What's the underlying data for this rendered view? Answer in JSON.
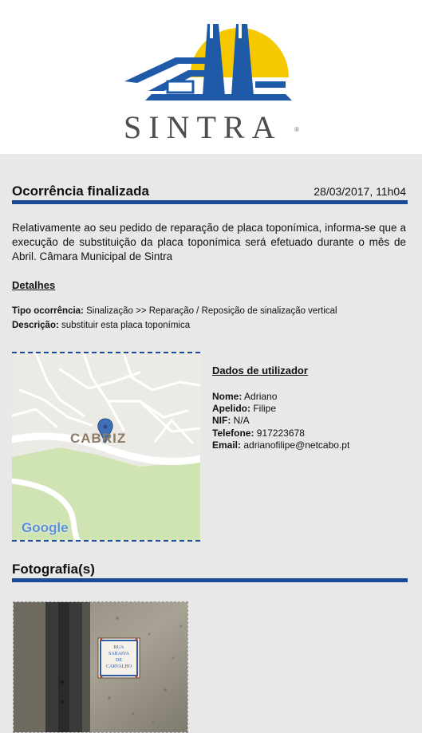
{
  "header": {
    "brand_text": "SINTRA",
    "brand_mark": "®"
  },
  "occurrence": {
    "title": "Ocorrência finalizada",
    "date": "28/03/2017, 11h04",
    "message": "Relativamente ao seu pedido de reparação de placa toponímica, informa-se que a execução de substituição da placa toponímica será efetuado durante o mês de Abril. Câmara Municipal de Sintra"
  },
  "details": {
    "heading": "Detalhes",
    "type_label": "Tipo ocorrência:",
    "type_value": "Sinalização >> Reparação / Reposição de sinalização vertical",
    "description_label": "Descrição:",
    "description_value": "substituir esta placa toponímica"
  },
  "map": {
    "place_label": "CABRIZ",
    "attribution": "Google",
    "marker_icon": "map-pin-icon"
  },
  "user": {
    "heading": "Dados de utilizador",
    "name_label": "Nome:",
    "name_value": "Adriano",
    "surname_label": "Apelido:",
    "surname_value": "Filipe",
    "nif_label": "NIF:",
    "nif_value": "N/A",
    "phone_label": "Telefone:",
    "phone_value": "917223678",
    "email_label": "Email:",
    "email_value": "adrianofilipe@netcabo.pt"
  },
  "photos": {
    "heading": "Fotografia(s)",
    "sign_text_1": "RUA",
    "sign_text_2": "SARAIVA",
    "sign_text_3": "DE",
    "sign_text_4": "CARVALHO"
  },
  "colors": {
    "accent": "#1a4a98",
    "logo_sun": "#f6c800",
    "logo_blue": "#1e5aa8",
    "background": "#e8e8e8"
  }
}
